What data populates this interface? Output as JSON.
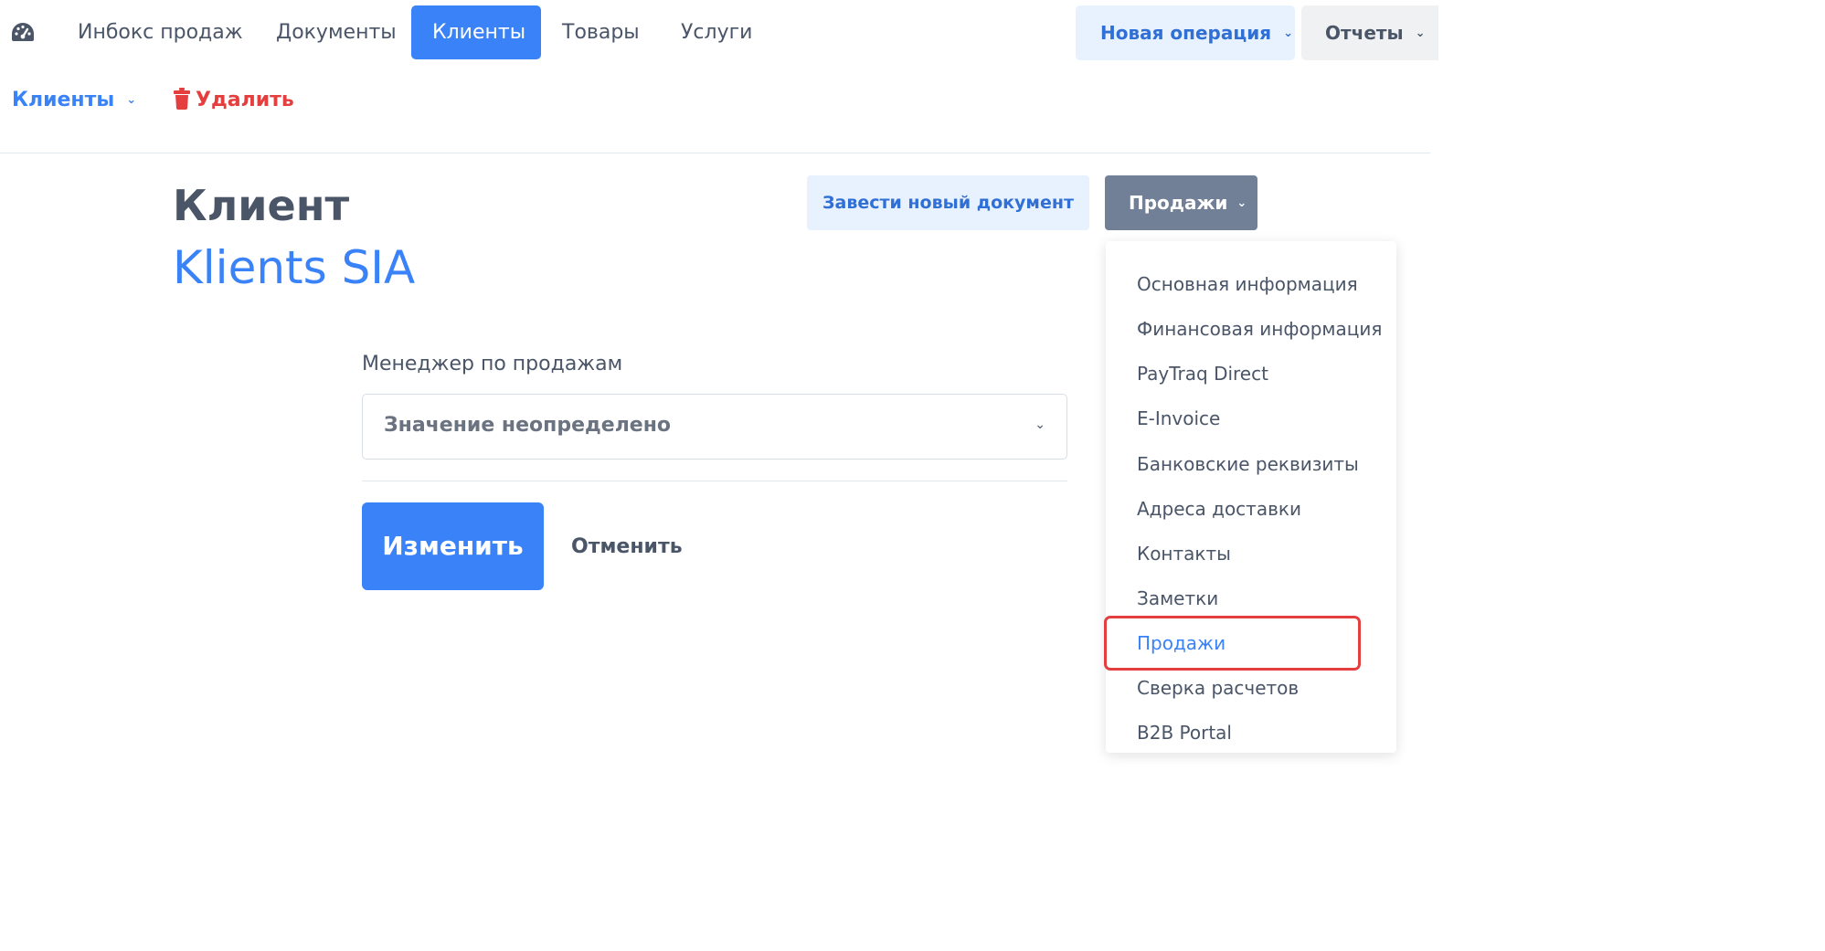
{
  "topnav": {
    "items": [
      {
        "label": "Инбокс продаж"
      },
      {
        "label": "Документы"
      },
      {
        "label": "Клиенты"
      },
      {
        "label": "Товары"
      },
      {
        "label": "Услуги"
      }
    ],
    "active_item": "Клиенты",
    "new_operation_label": "Новая операция",
    "reports_label": "Отчеты"
  },
  "subnav": {
    "clients_label": "Клиенты",
    "delete_label": "Удалить"
  },
  "page": {
    "title": "Клиент",
    "client_name": "Klients SIA"
  },
  "actions": {
    "new_document_label": "Завести новый документ",
    "sales_label": "Продажи"
  },
  "dropdown": {
    "items": [
      {
        "label": "Основная информация"
      },
      {
        "label": "Финансовая информация"
      },
      {
        "label": "PayTraq Direct"
      },
      {
        "label": "E-Invoice"
      },
      {
        "label": "Банковские реквизиты"
      },
      {
        "label": "Адреса доставки"
      },
      {
        "label": "Контакты"
      },
      {
        "label": "Заметки"
      },
      {
        "label": "Продажи"
      },
      {
        "label": "Сверка расчетов"
      },
      {
        "label": "B2B Portal"
      }
    ],
    "current_item": "Продажи"
  },
  "form": {
    "manager_label": "Менеджер по продажам",
    "manager_value": "Значение неопределено",
    "save_label": "Изменить",
    "cancel_label": "Отменить"
  },
  "colors": {
    "primary": "#3a82f7",
    "danger": "#e53e3e",
    "text": "#4a5568",
    "secondary_button": "#718096",
    "light_blue": "#e8f1fe"
  }
}
